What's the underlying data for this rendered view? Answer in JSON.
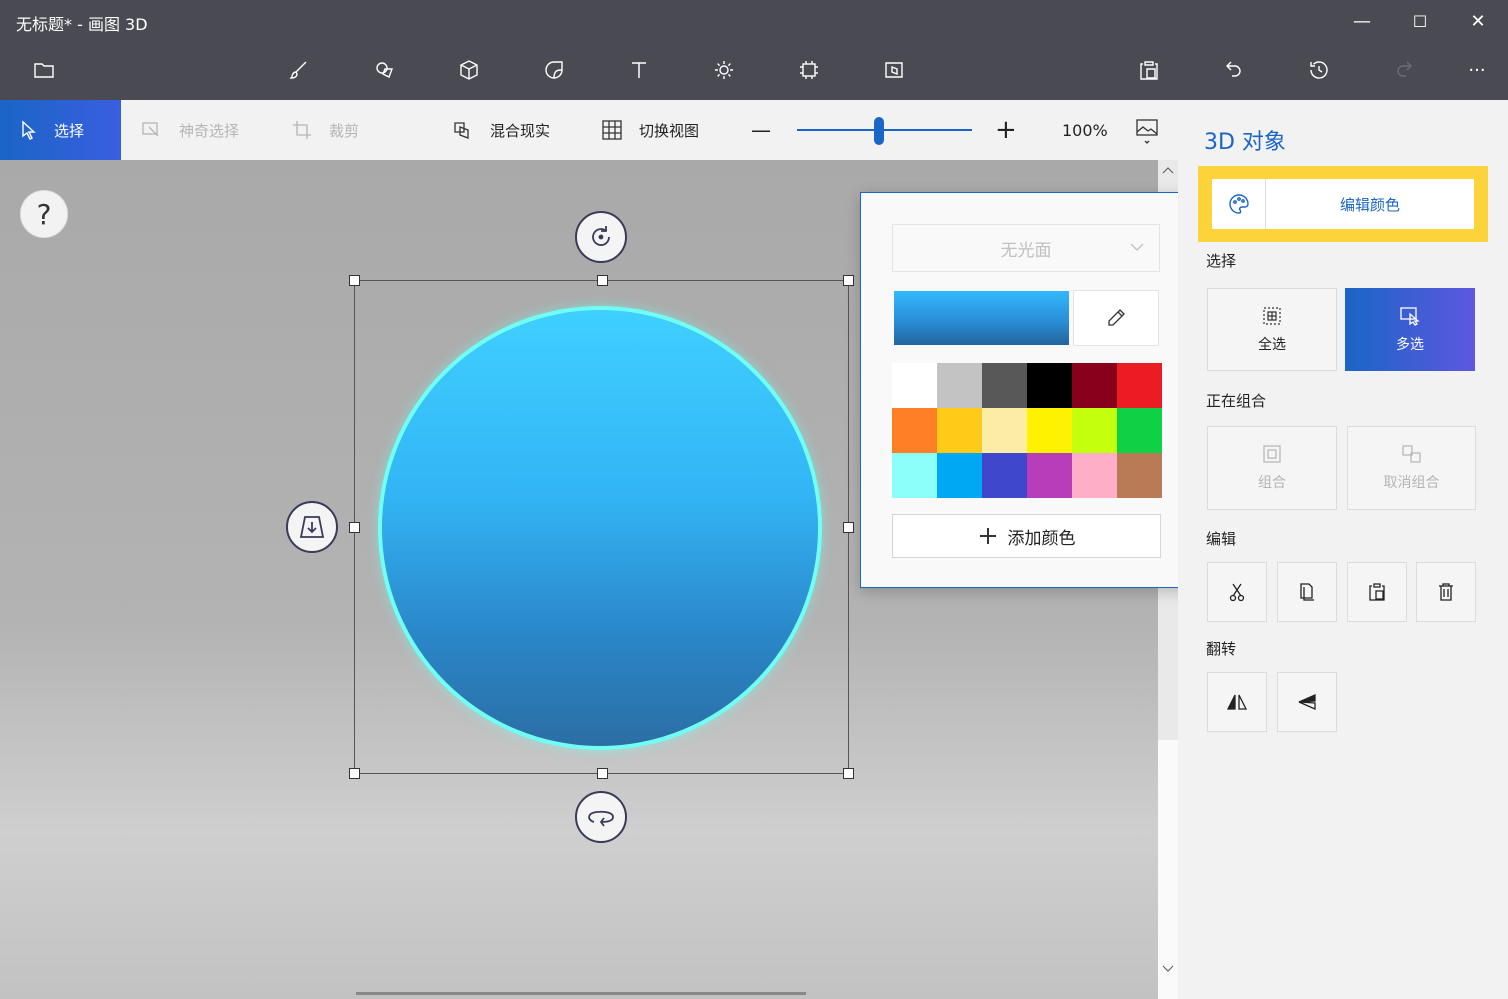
{
  "window": {
    "title": "无标题* - 画图 3D",
    "minimize": "—",
    "maximize": "☐",
    "close": "✕"
  },
  "toolbar": {
    "icons": [
      "folder-icon",
      "brush-icon",
      "2d-shapes-icon",
      "3d-shapes-icon",
      "stickers-icon",
      "text-icon",
      "effects-icon",
      "canvas-icon",
      "3d-library-icon",
      "paste-icon",
      "undo-icon",
      "history-icon",
      "redo-icon",
      "more-icon"
    ],
    "more_label": "···"
  },
  "subbar": {
    "select": "选择",
    "magic_select": "神奇选择",
    "crop": "裁剪",
    "mixed_reality": "混合现实",
    "switch_view": "切换视图",
    "zoom_minus": "—",
    "zoom_plus": "+",
    "zoom_level": "100%"
  },
  "zoom": {
    "slider_value": 0.47
  },
  "canvas": {
    "help": "?"
  },
  "color_popup": {
    "finish": "无光面",
    "add_color": "添加颜色",
    "palette": [
      "#ffffff",
      "#c3c3c3",
      "#585858",
      "#000000",
      "#88001b",
      "#ec1c24",
      "#ff7f27",
      "#ffca18",
      "#fdeca6",
      "#fff200",
      "#c4ff0e",
      "#0ed145",
      "#8cfffb",
      "#00a8f3",
      "#3f48cc",
      "#b83dba",
      "#ffaec8",
      "#b97a56"
    ],
    "current_color": "#2a8ed7"
  },
  "panel": {
    "title": "3D 对象",
    "edit_color": "编辑颜色",
    "select_section": "选择",
    "select_all": "全选",
    "multi_select": "多选",
    "group_section": "正在组合",
    "group": "组合",
    "ungroup": "取消组合",
    "edit_section": "编辑",
    "flip_section": "翻转"
  },
  "colors": {
    "accent": "#1a65c6",
    "highlight": "#fcd33b",
    "titlebar": "#4a4b52"
  }
}
